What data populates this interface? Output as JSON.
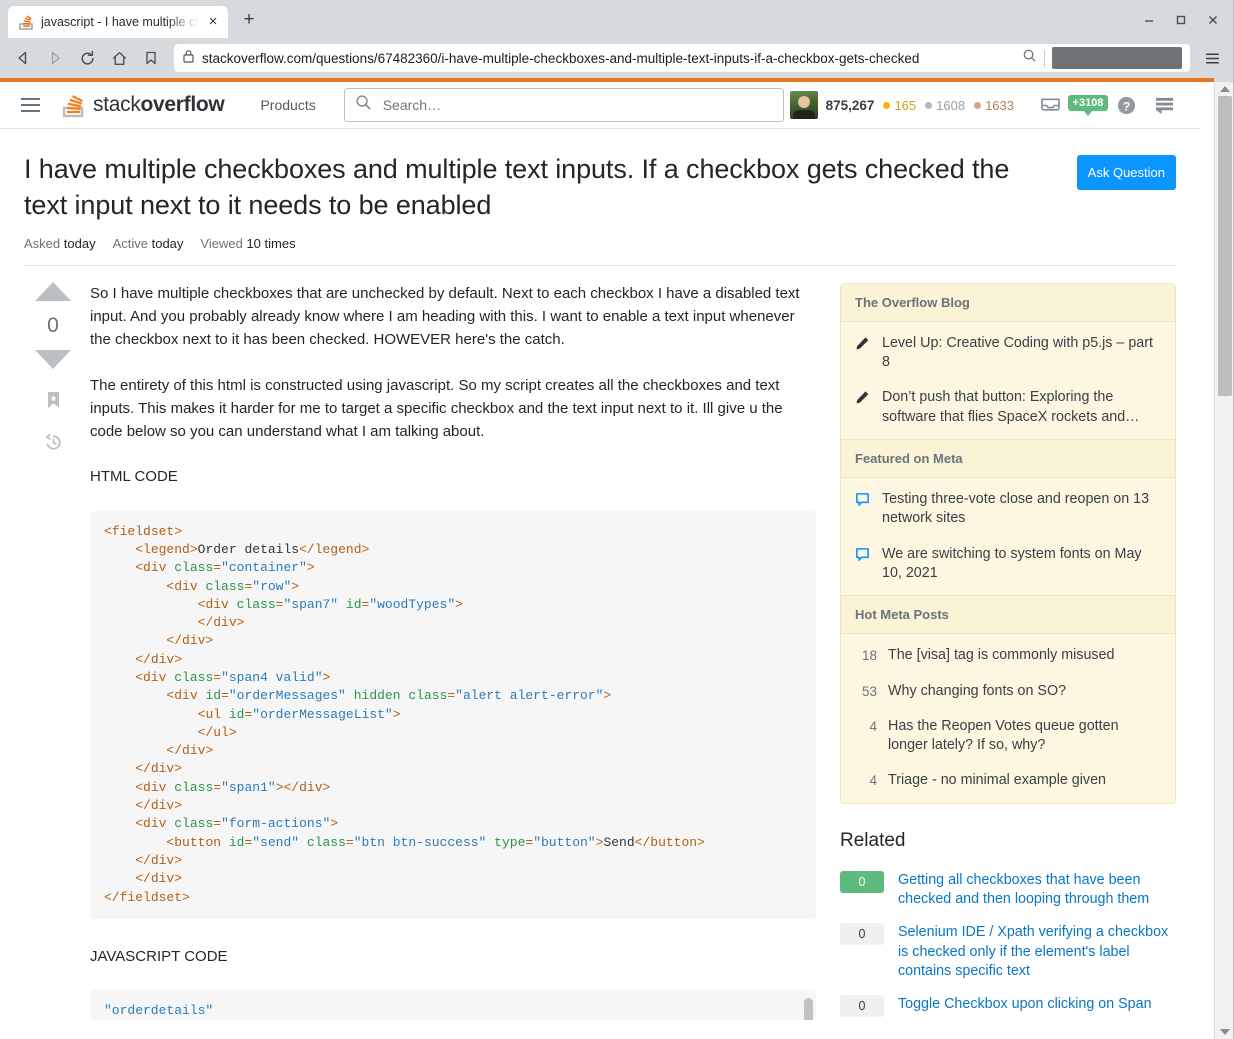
{
  "browser": {
    "tab_title": "javascript - I have multiple che",
    "tab_favicon": "stackoverflow-favicon",
    "new_tab_label": "+",
    "close_tab_label": "×",
    "window_minimize": "—",
    "window_maximize": "❐",
    "window_close": "✕",
    "url": "stackoverflow.com/questions/67482360/i-have-multiple-checkboxes-and-multiple-text-inputs-if-a-checkbox-gets-checked",
    "back_label": "◁",
    "forward_label": "▷",
    "reload_label": "↻",
    "home_label": "⌂",
    "bookmark_label": "▭",
    "menu_label": "☰"
  },
  "topnav": {
    "logo_light": "stack",
    "logo_bold": "overflow",
    "products": "Products",
    "search_placeholder": "Search…",
    "search_value": "",
    "reputation": "875,267",
    "badges": [
      {
        "count": "165",
        "color": "#f1b600",
        "name": "gold"
      },
      {
        "count": "1608",
        "color": "#b4b8bc",
        "name": "silver"
      },
      {
        "count": "1633",
        "color": "#d1a684",
        "name": "bronze"
      }
    ],
    "achievements": "+3108",
    "inbox_icon": "inbox-icon",
    "help_icon": "help-icon",
    "sites_icon": "stack-exchange-icon"
  },
  "question": {
    "title": "I have multiple checkboxes and multiple text inputs. If a checkbox gets checked the text input next to it needs to be enabled",
    "ask_button": "Ask Question",
    "meta": [
      {
        "label": "Asked",
        "value": "today"
      },
      {
        "label": "Active",
        "value": "today"
      },
      {
        "label": "Viewed",
        "value": "10 times"
      }
    ],
    "vote_score": "0",
    "paragraphs": [
      "So I have multiple checkboxes that are unchecked by default. Next to each checkbox I have a disabled text input. And you probably already know where I am heading with this. I want to enable a text input whenever the checkbox next to it has been checked. HOWEVER here's the catch.",
      "The entirety of this html is constructed using javascript. So my script creates all the checkboxes and text inputs. This makes it harder for me to target a specific checkbox and the text input next to it. Ill give u the code below so you can understand what I am talking about."
    ],
    "html_code_label": "HTML CODE",
    "js_code_label": "JAVASCRIPT CODE",
    "html_code_lines": [
      "<fieldset>",
      "    <legend>Order details</legend>",
      "    <div class=\"container\">",
      "        <div class=\"row\">",
      "            <div class=\"span7\" id=\"woodTypes\">",
      "            </div>",
      "        </div>",
      "    </div>",
      "    <div class=\"span4 valid\">",
      "        <div id=\"orderMessages\" hidden class=\"alert alert-error\">",
      "            <ul id=\"orderMessageList\">",
      "            </ul>",
      "        </div>",
      "    </div>",
      "    <div class=\"span1\"></div>",
      "    </div>",
      "    <div class=\"form-actions\">",
      "        <button id=\"send\" class=\"btn btn-success\" type=\"button\">Send</button>",
      "    </div>",
      "    </div>",
      "</fieldset>"
    ],
    "js_code_first_line": "\"orderdetails\""
  },
  "sidebar": {
    "blog": {
      "heading": "The Overflow Blog",
      "items": [
        {
          "icon": "pencil-icon",
          "text": "Level Up: Creative Coding with p5.js – part 8"
        },
        {
          "icon": "pencil-icon",
          "text": "Don’t push that button: Exploring the software that flies SpaceX rockets and…"
        }
      ]
    },
    "meta": {
      "heading": "Featured on Meta",
      "items": [
        {
          "icon": "speech-bubble-icon",
          "text": "Testing three-vote close and reopen on 13 network sites"
        },
        {
          "icon": "speech-bubble-icon",
          "text": "We are switching to system fonts on May 10, 2021"
        }
      ]
    },
    "hot": {
      "heading": "Hot Meta Posts",
      "items": [
        {
          "score": "18",
          "text": "The [visa] tag is commonly misused"
        },
        {
          "score": "53",
          "text": "Why changing fonts on SO?"
        },
        {
          "score": "4",
          "text": "Has the Reopen Votes queue gotten longer lately? If so, why?"
        },
        {
          "score": "4",
          "text": "Triage - no minimal example given"
        }
      ]
    },
    "related": {
      "heading": "Related",
      "items": [
        {
          "score": "0",
          "answered": true,
          "text": "Getting all checkboxes that have been checked and then looping through them"
        },
        {
          "score": "0",
          "answered": false,
          "text": "Selenium IDE / Xpath verifying a checkbox is checked only if the element's label contains specific text"
        },
        {
          "score": "0",
          "answered": false,
          "text": "Toggle Checkbox upon clicking on Span"
        }
      ]
    }
  },
  "colors": {
    "accent_orange": "#e87722",
    "link_blue": "#0a76c4",
    "button_blue": "#0a95ff",
    "answered_green": "#5eba7d",
    "card_bg": "#fdf7e2"
  }
}
